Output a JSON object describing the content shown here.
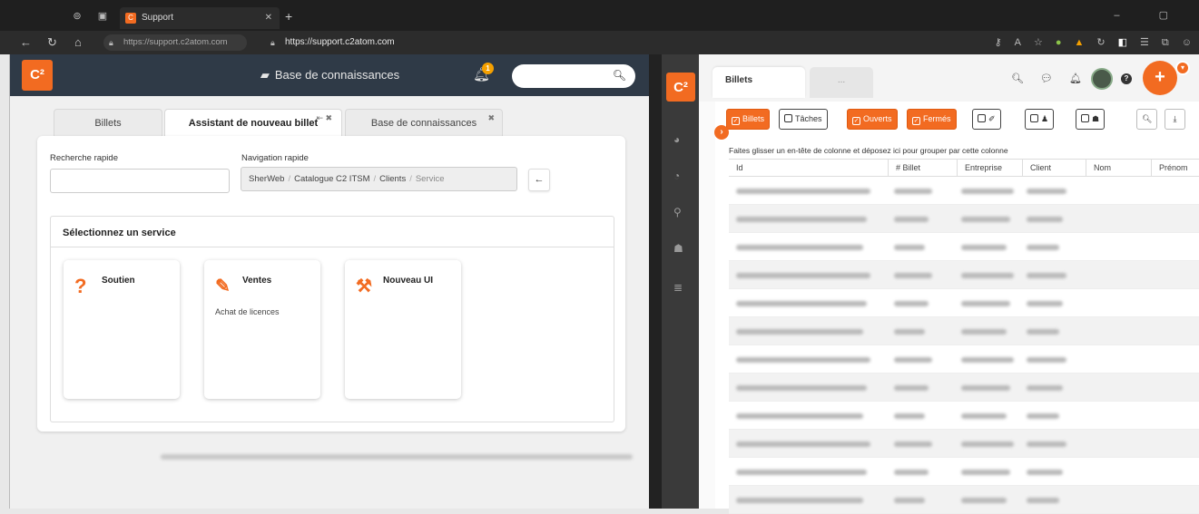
{
  "browser": {
    "tab_title": "Support",
    "tab_favicon": "C",
    "url_left": "https://support.c2atom.com",
    "url_right": "https://support.c2atom.com"
  },
  "left": {
    "logo": "C²",
    "header_title": "Base de connaissances",
    "notification_count": "1",
    "tabs": [
      "Billets",
      "Assistant de nouveau billet",
      "Base de connaissances"
    ],
    "quick_search_label": "Recherche rapide",
    "quick_nav_label": "Navigation rapide",
    "breadcrumb": [
      "SherWeb",
      "Catalogue C2 ITSM",
      "Clients",
      "Service"
    ],
    "select_service_title": "Sélectionnez un service",
    "services": [
      {
        "name": "Soutien",
        "desc": "",
        "icon": "question-icon"
      },
      {
        "name": "Ventes",
        "desc": "Achat de licences",
        "icon": "pencil-icon"
      },
      {
        "name": "Nouveau UI",
        "desc": "",
        "icon": "wrench-icon"
      }
    ]
  },
  "right": {
    "logo": "C²",
    "tabs": [
      "Billets",
      "..."
    ],
    "filters": {
      "billets": "Billets",
      "taches": "Tâches",
      "ouverts": "Ouverts",
      "fermes": "Fermés"
    },
    "group_hint": "Faites glisser un en-tête de colonne et déposez ici pour grouper par cette colonne",
    "columns": [
      "Id",
      "# Billet",
      "Entreprise",
      "Client",
      "Nom",
      "Prénom"
    ],
    "accent": "#f26b21"
  }
}
